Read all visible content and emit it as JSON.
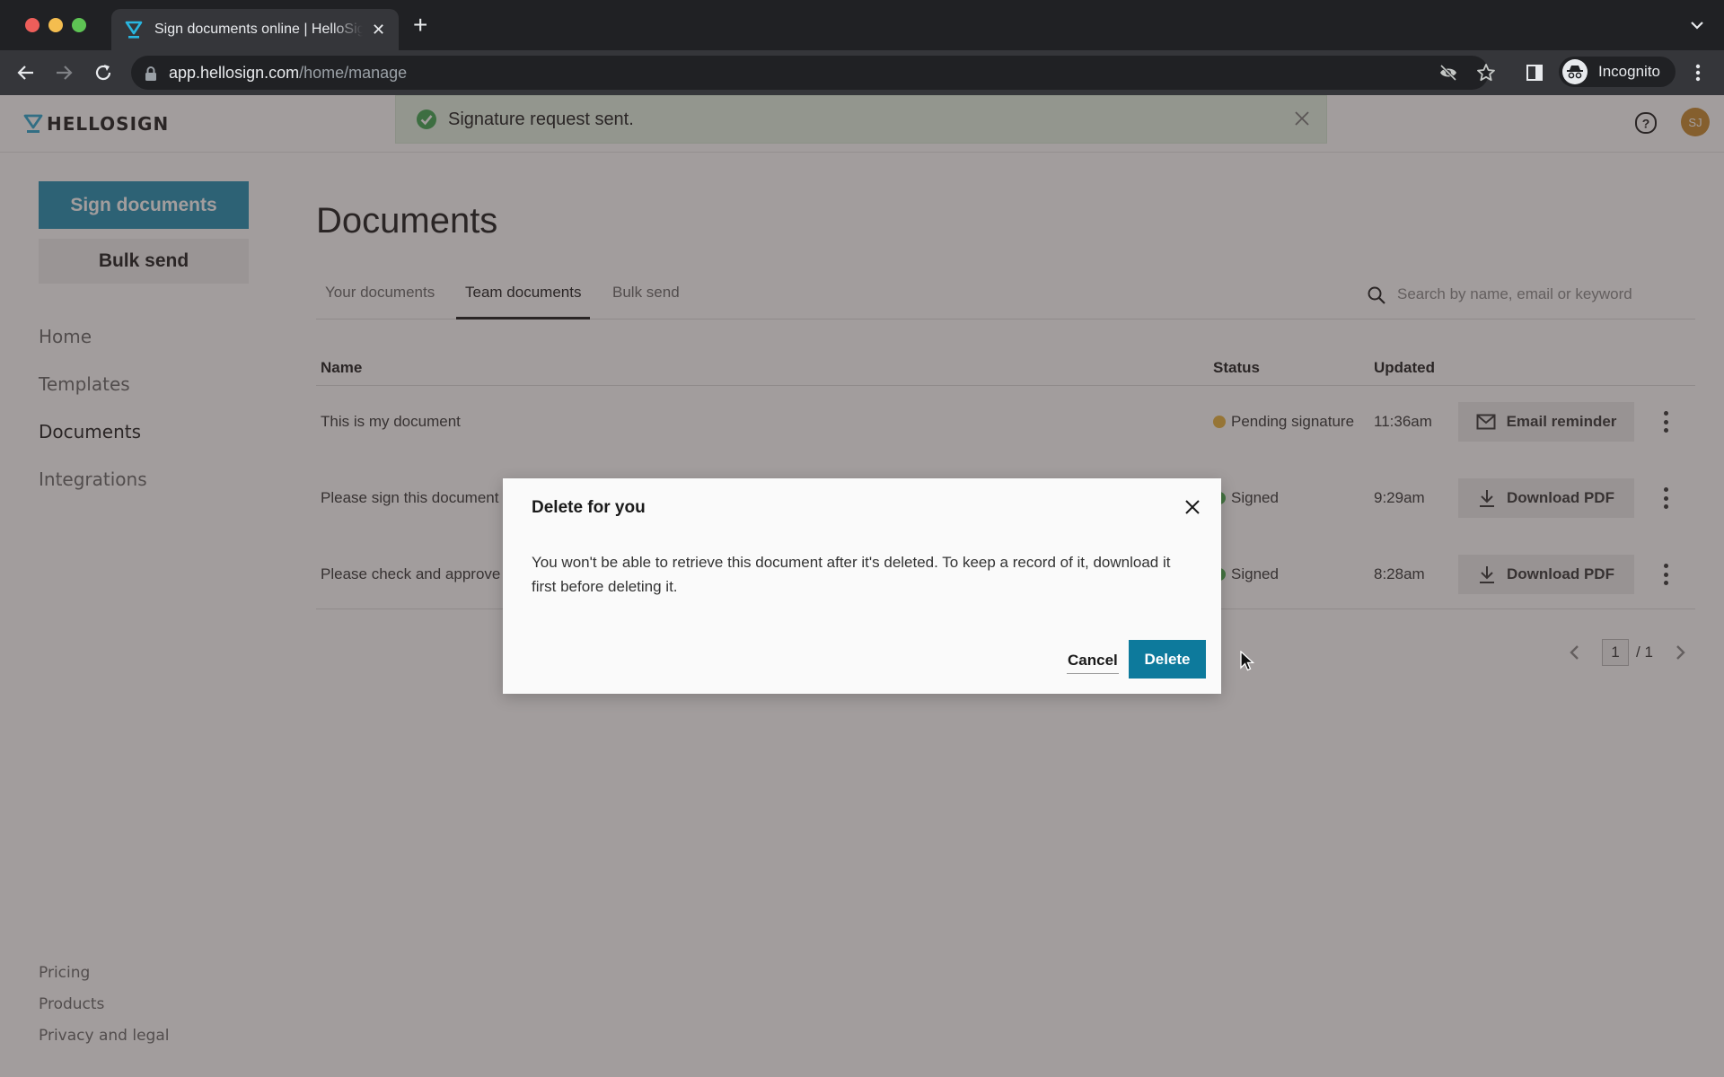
{
  "browser": {
    "tab_title": "Sign documents online | HelloSign",
    "url_host": "app.hellosign.com",
    "url_path": "/home/manage",
    "profile_label": "Incognito"
  },
  "header": {
    "logo_text": "HELLOSIGN",
    "toast_message": "Signature request sent.",
    "user_initials": "SJ",
    "brand_color": "#1f8fb3",
    "avatar_color": "#c8892b"
  },
  "sidebar": {
    "primary_button": "Sign documents",
    "secondary_button": "Bulk send",
    "nav": [
      {
        "label": "Home",
        "active": false
      },
      {
        "label": "Templates",
        "active": false
      },
      {
        "label": "Documents",
        "active": true
      },
      {
        "label": "Integrations",
        "active": false
      }
    ],
    "footer": [
      "Pricing",
      "Products",
      "Privacy and legal"
    ]
  },
  "main": {
    "title": "Documents",
    "tabs": [
      {
        "label": "Your documents",
        "active": false
      },
      {
        "label": "Team documents",
        "active": true
      },
      {
        "label": "Bulk send",
        "active": false
      }
    ],
    "search_placeholder": "Search by name, email or keyword",
    "columns": [
      "Name",
      "Status",
      "Updated"
    ],
    "rows": [
      {
        "name": "This is my document",
        "status": "Pending signature",
        "status_color": "#e8b33a",
        "updated": "11:36am",
        "action": "Email reminder",
        "action_icon": "mail-icon"
      },
      {
        "name": "Please sign this document",
        "status": "Signed",
        "status_color": "#4caf50",
        "updated": "9:29am",
        "action": "Download PDF",
        "action_icon": "download-icon"
      },
      {
        "name": "Please check and approve",
        "status": "Signed",
        "status_color": "#4caf50",
        "updated": "8:28am",
        "action": "Download PDF",
        "action_icon": "download-icon"
      }
    ],
    "pagination": {
      "current": "1",
      "total": "/ 1"
    }
  },
  "modal": {
    "title": "Delete for you",
    "body": "You won't be able to retrieve this document after it's deleted. To keep a record of it, download it first before deleting it.",
    "cancel_label": "Cancel",
    "confirm_label": "Delete",
    "confirm_color": "#0d7a9c"
  }
}
